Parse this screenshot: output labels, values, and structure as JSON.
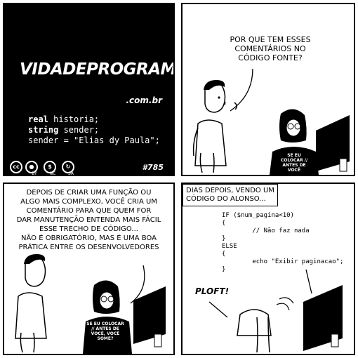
{
  "panel1": {
    "logo": "VidaDeProgramador",
    "domain": ".com.br",
    "code_lines": [
      {
        "kw": "real",
        "rest": " historia;"
      },
      {
        "kw": "string",
        "rest": " sender;"
      },
      {
        "kw": "",
        "rest": "sender = \"Elias dy Paula\";"
      }
    ],
    "license": [
      "BY",
      "NC",
      "SA"
    ],
    "episode": "#785"
  },
  "panel2": {
    "speech": [
      "POR QUE TEM ESSES",
      "COMENTÁRIOS NO",
      "CÓDIGO FONTE?"
    ],
    "shirt_text": "SE EU COLOCAR // ANTES DE VOCÊ"
  },
  "panel3": {
    "speech": [
      "DEPOIS DE CRIAR UMA FUNÇÃO OU",
      "ALGO MAIS COMPLEXO, VOCÊ CRIA UM",
      "COMENTÁRIO PARA QUE QUEM FOR",
      "DAR MANUTENÇÃO ENTENDA MAIS FÁCIL",
      "ESSE TRECHO DE CÓDIGO...",
      "NÃO É OBRIGATÓRIO, MAS É UMA BOA",
      "PRÁTICA ENTRE OS DESENVOLVEDORES"
    ],
    "shirt_text": "SE EU COLOCAR // ANTES DE VOCÊ, VOCÊ SOME?"
  },
  "panel4": {
    "caption": [
      "DIAS DEPOIS, VENDO UM",
      "CÓDIGO DO ALONSO..."
    ],
    "code": [
      "IF ($num_pagina<10)",
      "{",
      "        // Não faz nada",
      "}",
      "ELSE",
      "{",
      "        echo \"Exibir paginacao\";",
      "}"
    ],
    "sfx": "PLOFT!"
  }
}
